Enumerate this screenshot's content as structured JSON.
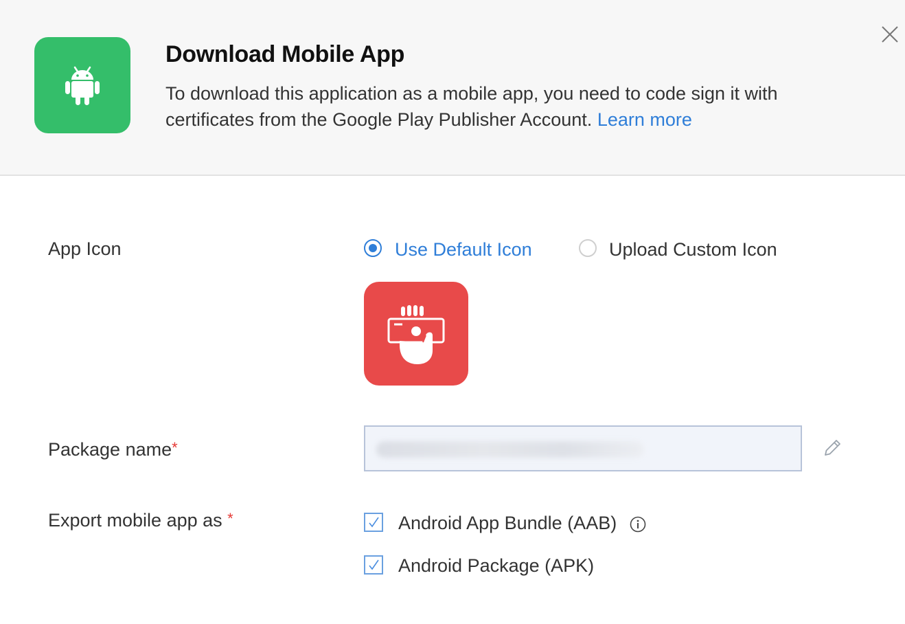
{
  "header": {
    "title": "Download Mobile App",
    "description": "To download this application as a mobile app, you need to code sign it with certificates from the Google Play Publisher Account.",
    "learn_more": "Learn more",
    "icon": "android-icon"
  },
  "app_icon": {
    "label": "App Icon",
    "options": [
      {
        "label": "Use Default Icon",
        "selected": true
      },
      {
        "label": "Upload Custom Icon",
        "selected": false
      }
    ],
    "preview_icon": "hand-holding-money-icon",
    "accent_color": "#e84a4a"
  },
  "package_name": {
    "label": "Package name",
    "required_mark": "*",
    "value": ""
  },
  "export": {
    "label": "Export mobile app as",
    "required_mark": "*",
    "options": [
      {
        "label": "Android App Bundle (AAB)",
        "checked": true,
        "has_info": true
      },
      {
        "label": "Android Package (APK)",
        "checked": true,
        "has_info": false
      }
    ]
  },
  "colors": {
    "android_green": "#34be6a",
    "link_blue": "#2f7ed8",
    "required_red": "#e53935"
  }
}
